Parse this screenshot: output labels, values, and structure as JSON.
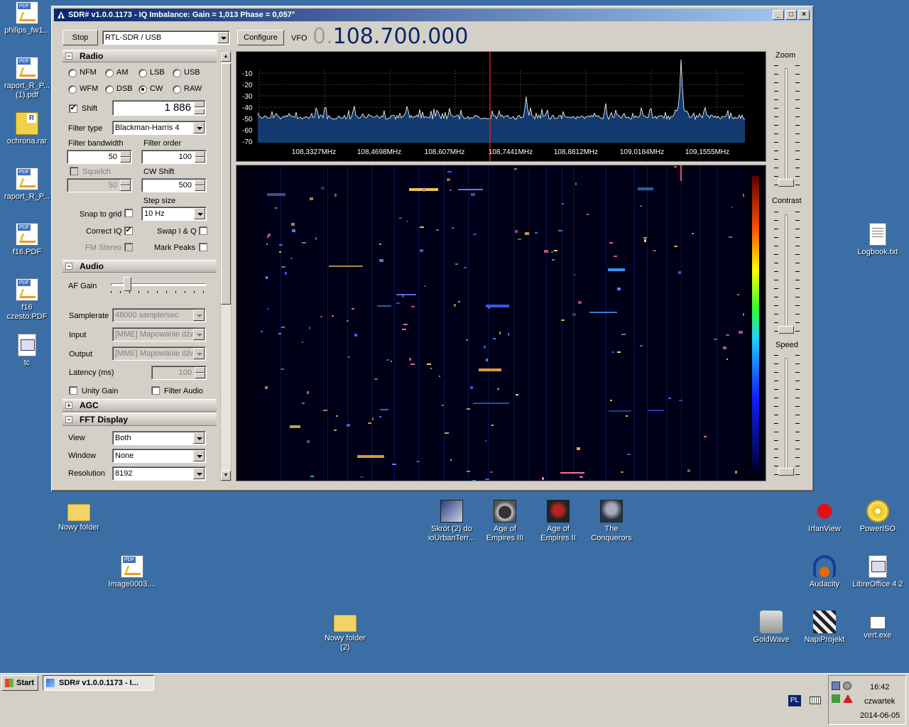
{
  "desktop": {
    "left_icons": [
      {
        "label": "philips_fw1...",
        "icon": "pdf-icon"
      },
      {
        "label": "raport_R_P...\n(1).pdf",
        "icon": "pdf-icon"
      },
      {
        "label": "ochrona.rar",
        "icon": "rar-icon"
      },
      {
        "label": "raport_R_P...",
        "icon": "pdf-icon"
      },
      {
        "label": "f16.PDF",
        "icon": "pdf-icon"
      },
      {
        "label": "f16\nczesto.PDF",
        "icon": "pdf-icon"
      },
      {
        "label": "tc",
        "icon": "app-icon"
      }
    ],
    "logbook": "Logbook.txt",
    "nowy_folder": "Nowy folder",
    "image0003": "Image0003....",
    "nowy_folder_2": "Nowy folder\n(2)",
    "shortcut_urbanterror": "Skrót (2) do\nioUrbanTerr...",
    "aoe3": "Age of\nEmpires III",
    "aoe2": "Age of\nEmpires II",
    "conquerors": "The\nConquerors",
    "irfanview": "IrfanView",
    "poweriso": "PowerISO",
    "audacity": "Audacity",
    "libreoffice": "LibreOffice 4.2",
    "goldwave": "GoldWave",
    "napiprojekt": "NapiProjekt",
    "vert": "vert.exe"
  },
  "window": {
    "title": "SDR# v1.0.0.1173 - IQ Imbalance: Gain = 1,013 Phase = 0,057°",
    "minimize": "_",
    "maximize": "□",
    "close": "×"
  },
  "toolbar": {
    "stop": "Stop",
    "device": "RTL-SDR / USB",
    "configure": "Configure",
    "vfo_label": "VFO",
    "vfo_dim": "0.",
    "vfo_value": "108.700.000"
  },
  "radio": {
    "title": "Radio",
    "modes": [
      {
        "label": "NFM",
        "checked": false
      },
      {
        "label": "AM",
        "checked": false
      },
      {
        "label": "LSB",
        "checked": false
      },
      {
        "label": "USB",
        "checked": false
      },
      {
        "label": "WFM",
        "checked": false
      },
      {
        "label": "DSB",
        "checked": false
      },
      {
        "label": "CW",
        "checked": true
      },
      {
        "label": "RAW",
        "checked": false
      }
    ],
    "shift_label": "Shift",
    "shift_checked": true,
    "shift_value": "1 886",
    "filter_type_label": "Filter type",
    "filter_type_value": "Blackman-Harris 4",
    "filter_bandwidth_label": "Filter bandwidth",
    "filter_bandwidth_value": "50",
    "filter_order_label": "Filter order",
    "filter_order_value": "100",
    "squelch_label": "Squelch",
    "squelch_value": "50",
    "cw_shift_label": "CW Shift",
    "cw_shift_value": "500",
    "step_size_label": "Step size",
    "snap_to_grid_label": "Snap to grid",
    "snap_to_grid_checked": false,
    "step_size_value": "10 Hz",
    "correct_iq_label": "Correct IQ",
    "correct_iq_checked": true,
    "swap_iq_label": "Swap I & Q",
    "swap_iq_checked": false,
    "fm_stereo_label": "FM Stereo",
    "fm_stereo_checked": false,
    "mark_peaks_label": "Mark Peaks",
    "mark_peaks_checked": false
  },
  "audio": {
    "title": "Audio",
    "af_gain_label": "AF Gain",
    "af_gain_level": 0.15,
    "samplerate_label": "Samplerate",
    "samplerate_value": "48000 sample/sec",
    "input_label": "Input",
    "input_value": "[MME] Mapowanie dźw",
    "output_label": "Output",
    "output_value": "[MME] Mapowanie dźw",
    "latency_label": "Latency (ms)",
    "latency_value": "100",
    "unity_gain_label": "Unity Gain",
    "unity_gain_checked": false,
    "filter_audio_label": "Filter Audio",
    "filter_audio_checked": false
  },
  "agc": {
    "title": "AGC"
  },
  "fft": {
    "title": "FFT Display",
    "view_label": "View",
    "view_value": "Both",
    "window_label": "Window",
    "window_value": "None",
    "resolution_label": "Resolution",
    "resolution_value": "8192"
  },
  "spectrum": {
    "y_ticks": [
      "-10",
      "-20",
      "-30",
      "-40",
      "-50",
      "-60",
      "-70"
    ],
    "x_ticks": [
      "108,3327MHz",
      "108,4698MHz",
      "108,607MHz",
      "108,7441MHz",
      "108,8812MHz",
      "109,0184MHz",
      "109,1555MHz"
    ]
  },
  "right_panel": {
    "zoom_label": "Zoom",
    "zoom_level": 0.02,
    "contrast_label": "Contrast",
    "contrast_level": 0.0,
    "speed_label": "Speed",
    "speed_level": 0.0
  },
  "taskbar": {
    "start": "Start",
    "task": "SDR# v1.0.0.1173 - I...",
    "lang": "PL",
    "time": "16:42",
    "day": "czwartek",
    "date": "2014-06-05"
  },
  "colors": {
    "desktop": "#3a6ea5",
    "titlebar_start": "#0a246a",
    "vfo_text": "#0a246a",
    "spectrum_fill": "#1a4a8a"
  }
}
